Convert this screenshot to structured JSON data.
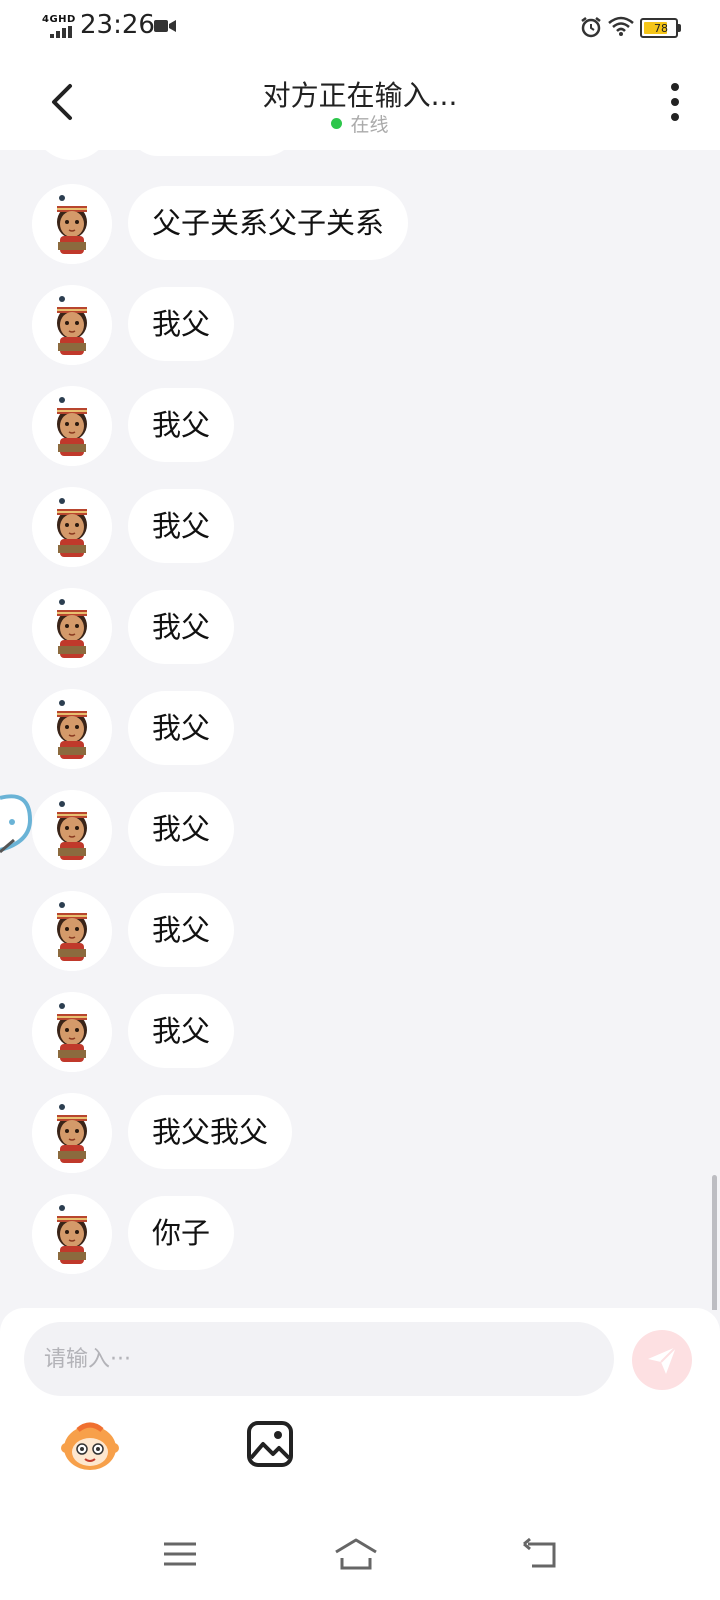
{
  "status_bar": {
    "network": "4GHD",
    "time": "23:26",
    "battery": "78",
    "battery_level": 0.78,
    "icons": [
      "signal-icon",
      "video-recording-icon",
      "alarm-icon",
      "wifi-icon",
      "battery-icon"
    ]
  },
  "header": {
    "title": "对方正在输入...",
    "status": "在线",
    "status_color": "#2dc64b",
    "icons": [
      "back-arrow-icon",
      "more-vertical-icon"
    ]
  },
  "messages": [
    {
      "text": "父子关系父子关系"
    },
    {
      "text": "我父"
    },
    {
      "text": "我父"
    },
    {
      "text": "我父"
    },
    {
      "text": "我父"
    },
    {
      "text": "我父"
    },
    {
      "text": "我父"
    },
    {
      "text": "我父"
    },
    {
      "text": "我父"
    },
    {
      "text": "我父我父"
    },
    {
      "text": "你子"
    }
  ],
  "composer": {
    "placeholder": "请输入···",
    "send_color": "#fde0e2",
    "icons": [
      "send-icon",
      "emoji-sticker-icon",
      "image-icon"
    ]
  },
  "nav_bar": {
    "icons": [
      "menu-icon",
      "home-icon",
      "back-icon"
    ]
  }
}
